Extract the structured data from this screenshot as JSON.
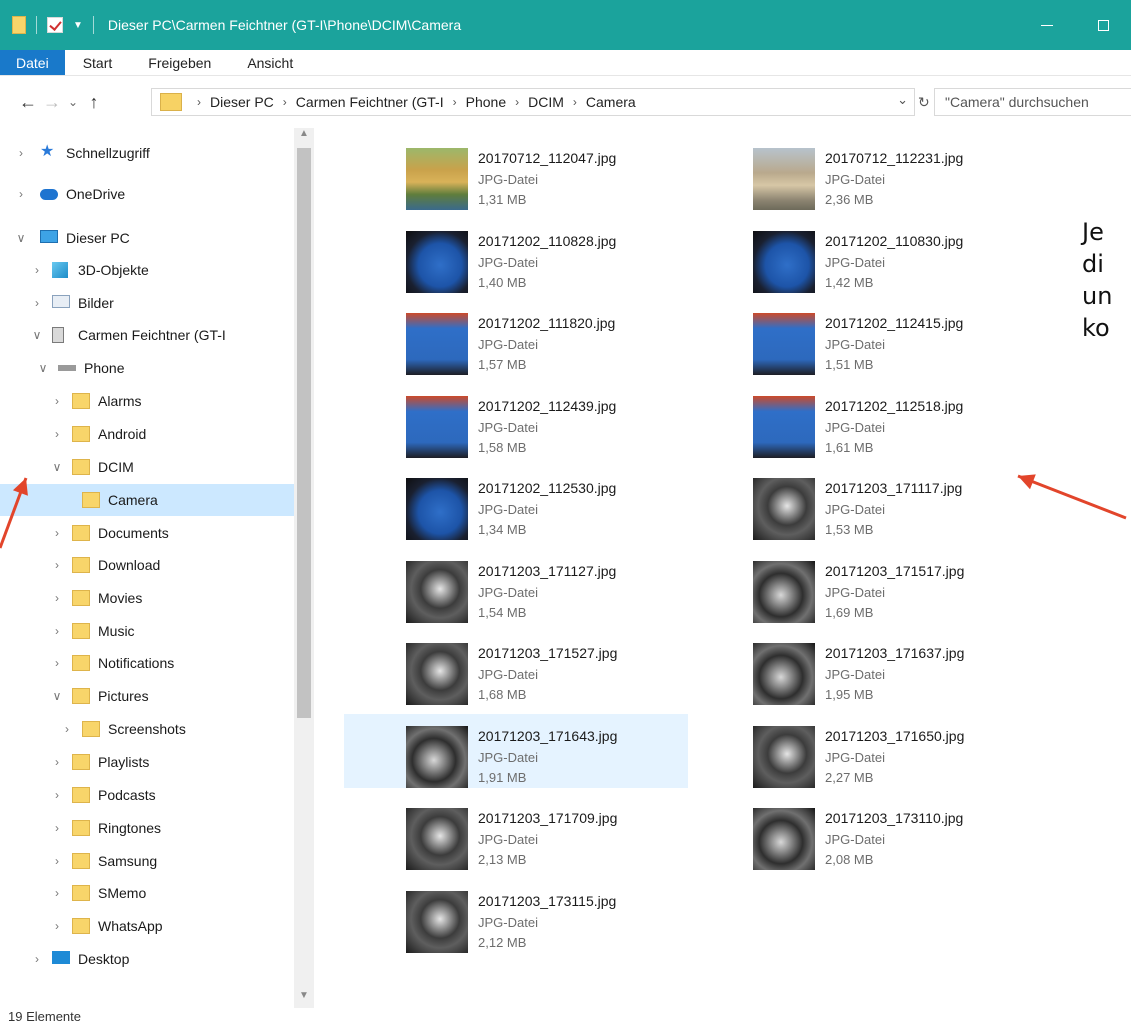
{
  "window": {
    "title": "Dieser PC\\Carmen Feichtner (GT-I\\Phone\\DCIM\\Camera"
  },
  "ribbon": {
    "tabs": [
      "Datei",
      "Start",
      "Freigeben",
      "Ansicht"
    ]
  },
  "address": {
    "crumbs": [
      "Dieser PC",
      "Carmen Feichtner (GT-I",
      "Phone",
      "DCIM",
      "Camera"
    ],
    "search_placeholder": "\"Camera\" durchsuchen"
  },
  "nav": {
    "items": [
      {
        "label": "Schnellzugriff",
        "icon": "star-icon",
        "chevron": "right",
        "level": 0
      },
      {
        "label": "OneDrive",
        "icon": "cloud-icon",
        "chevron": "right",
        "level": 0
      },
      {
        "label": "Dieser PC",
        "icon": "computer-icon",
        "chevron": "down",
        "level": 0
      },
      {
        "label": "3D-Objekte",
        "icon": "cube-icon",
        "chevron": "right",
        "level": 1
      },
      {
        "label": "Bilder",
        "icon": "pictures-icon",
        "chevron": "right",
        "level": 1
      },
      {
        "label": "Carmen Feichtner (GT-I",
        "icon": "phone-icon",
        "chevron": "down",
        "level": 1
      },
      {
        "label": "Phone",
        "icon": "drive-icon",
        "chevron": "down",
        "level": 2
      },
      {
        "label": "Alarms",
        "icon": "folder-icon",
        "chevron": "right",
        "level": 3
      },
      {
        "label": "Android",
        "icon": "folder-icon",
        "chevron": "right",
        "level": 3
      },
      {
        "label": "DCIM",
        "icon": "folder-icon",
        "chevron": "down",
        "level": 3
      },
      {
        "label": "Camera",
        "icon": "folder-icon",
        "chevron": "",
        "level": 4,
        "selected": true
      },
      {
        "label": "Documents",
        "icon": "folder-icon",
        "chevron": "right",
        "level": 3
      },
      {
        "label": "Download",
        "icon": "folder-icon",
        "chevron": "right",
        "level": 3
      },
      {
        "label": "Movies",
        "icon": "folder-icon",
        "chevron": "right",
        "level": 3
      },
      {
        "label": "Music",
        "icon": "folder-icon",
        "chevron": "right",
        "level": 3
      },
      {
        "label": "Notifications",
        "icon": "folder-icon",
        "chevron": "right",
        "level": 3
      },
      {
        "label": "Pictures",
        "icon": "folder-icon",
        "chevron": "down",
        "level": 3
      },
      {
        "label": "Screenshots",
        "icon": "folder-icon",
        "chevron": "right",
        "level": 4
      },
      {
        "label": "Playlists",
        "icon": "folder-icon",
        "chevron": "right",
        "level": 3
      },
      {
        "label": "Podcasts",
        "icon": "folder-icon",
        "chevron": "right",
        "level": 3
      },
      {
        "label": "Ringtones",
        "icon": "folder-icon",
        "chevron": "right",
        "level": 3
      },
      {
        "label": "Samsung",
        "icon": "folder-icon",
        "chevron": "right",
        "level": 3
      },
      {
        "label": "SMemo",
        "icon": "folder-icon",
        "chevron": "right",
        "level": 3
      },
      {
        "label": "WhatsApp",
        "icon": "folder-icon",
        "chevron": "right",
        "level": 3
      },
      {
        "label": "Desktop",
        "icon": "desktop-icon",
        "chevron": "right",
        "level": 1
      }
    ]
  },
  "files": [
    {
      "name": "20170712_112047.jpg",
      "type": "JPG-Datei",
      "size": "1,31 MB",
      "thumb": "golden"
    },
    {
      "name": "20170712_112231.jpg",
      "type": "JPG-Datei",
      "size": "2,36 MB",
      "thumb": "palace"
    },
    {
      "name": "20171202_110828.jpg",
      "type": "JPG-Datei",
      "size": "1,40 MB",
      "thumb": "screen"
    },
    {
      "name": "20171202_110830.jpg",
      "type": "JPG-Datei",
      "size": "1,42 MB",
      "thumb": "screen"
    },
    {
      "name": "20171202_111820.jpg",
      "type": "JPG-Datei",
      "size": "1,57 MB",
      "thumb": "screen2"
    },
    {
      "name": "20171202_112415.jpg",
      "type": "JPG-Datei",
      "size": "1,51 MB",
      "thumb": "screen2"
    },
    {
      "name": "20171202_112439.jpg",
      "type": "JPG-Datei",
      "size": "1,58 MB",
      "thumb": "screen2"
    },
    {
      "name": "20171202_112518.jpg",
      "type": "JPG-Datei",
      "size": "1,61 MB",
      "thumb": "screen2"
    },
    {
      "name": "20171202_112530.jpg",
      "type": "JPG-Datei",
      "size": "1,34 MB",
      "thumb": "screen"
    },
    {
      "name": "20171203_171117.jpg",
      "type": "JPG-Datei",
      "size": "1,53 MB",
      "thumb": "machine"
    },
    {
      "name": "20171203_171127.jpg",
      "type": "JPG-Datei",
      "size": "1,54 MB",
      "thumb": "machine"
    },
    {
      "name": "20171203_171517.jpg",
      "type": "JPG-Datei",
      "size": "1,69 MB",
      "thumb": "machine2"
    },
    {
      "name": "20171203_171527.jpg",
      "type": "JPG-Datei",
      "size": "1,68 MB",
      "thumb": "machine"
    },
    {
      "name": "20171203_171637.jpg",
      "type": "JPG-Datei",
      "size": "1,95 MB",
      "thumb": "machine2"
    },
    {
      "name": "20171203_171643.jpg",
      "type": "JPG-Datei",
      "size": "1,91 MB",
      "thumb": "machine2",
      "selected": true
    },
    {
      "name": "20171203_171650.jpg",
      "type": "JPG-Datei",
      "size": "2,27 MB",
      "thumb": "machine"
    },
    {
      "name": "20171203_171709.jpg",
      "type": "JPG-Datei",
      "size": "2,13 MB",
      "thumb": "machine"
    },
    {
      "name": "20171203_173110.jpg",
      "type": "JPG-Datei",
      "size": "2,08 MB",
      "thumb": "machine2"
    },
    {
      "name": "20171203_173115.jpg",
      "type": "JPG-Datei",
      "size": "2,12 MB",
      "thumb": "machine"
    }
  ],
  "status": {
    "count_text": "19 Elemente"
  },
  "annotation": {
    "lines": [
      "Je",
      "di",
      "un",
      "ko"
    ],
    "arrow_color": "#e2452b"
  },
  "colors": {
    "titlebar": "#1ba39c",
    "file_tab": "#1979ca",
    "selection": "#cce8ff",
    "folder": "#f8d56a"
  }
}
